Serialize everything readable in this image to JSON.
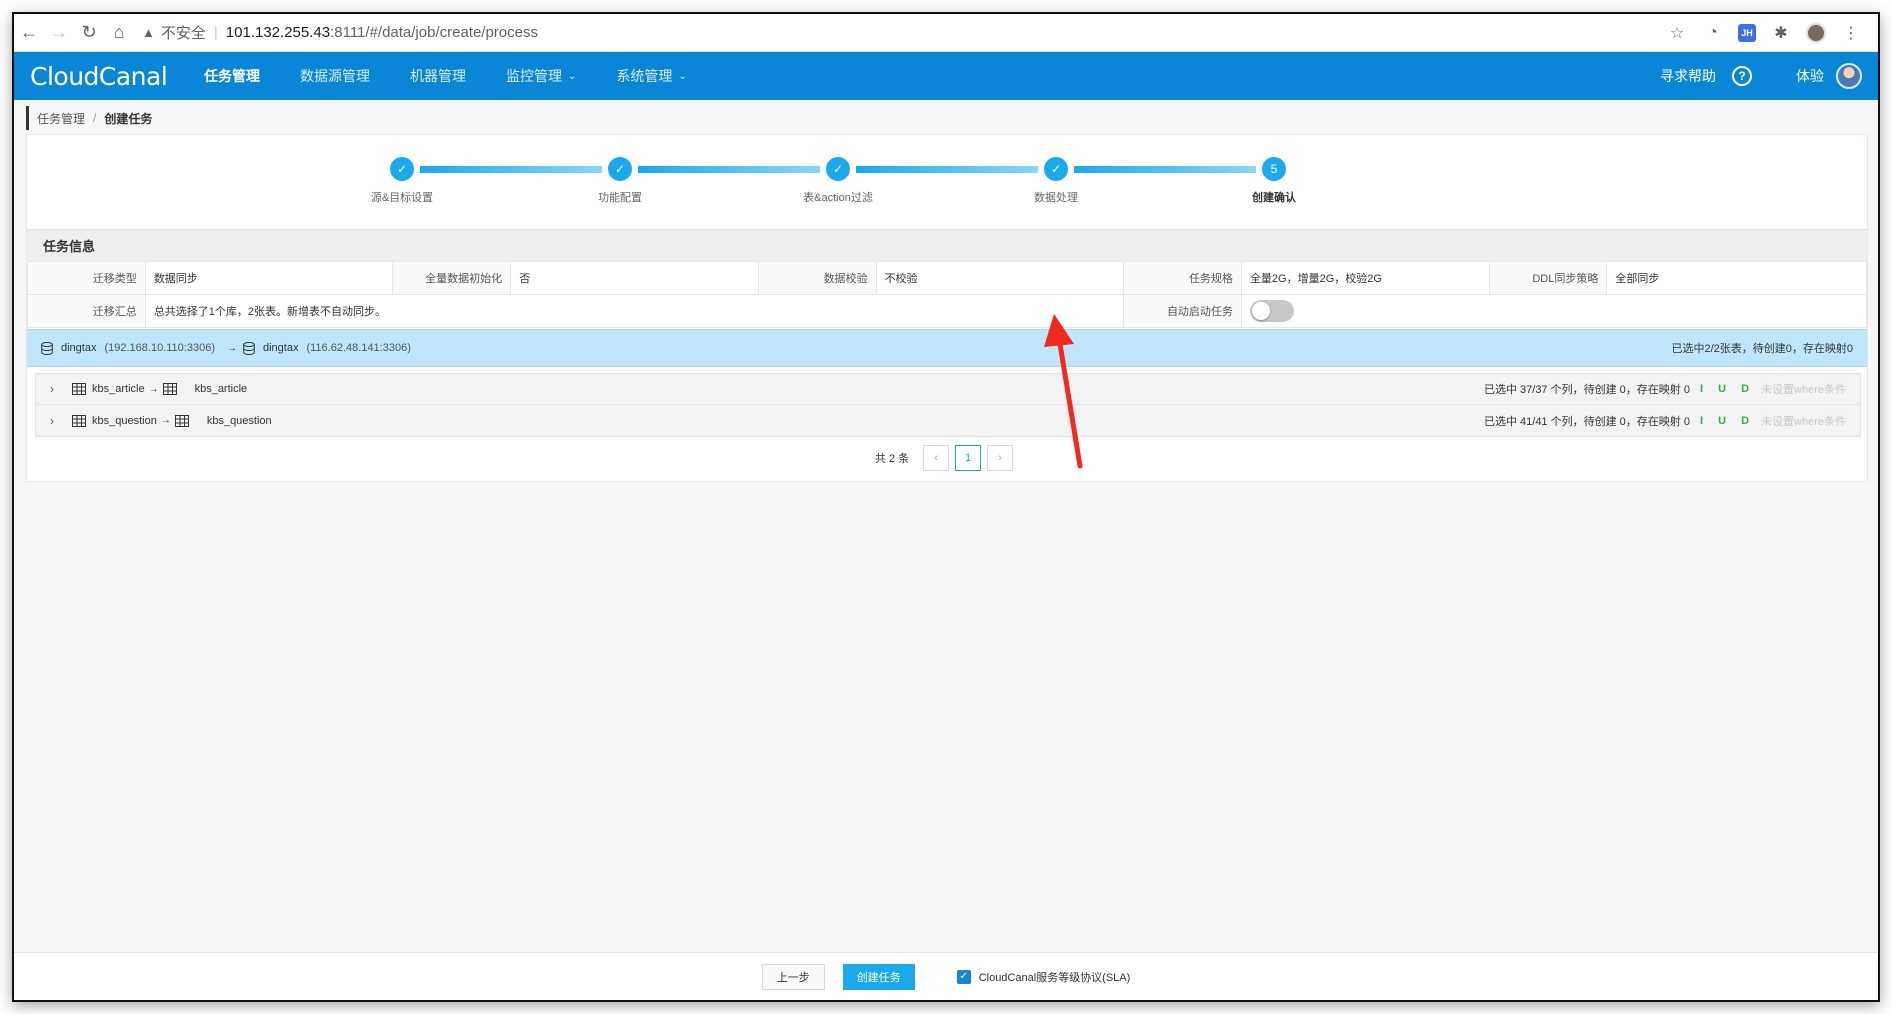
{
  "browser": {
    "insecure_label": "不安全",
    "url_host": "101.132.255.43",
    "url_path": ":8111/#/data/job/create/process"
  },
  "app": {
    "logo": "CloudCanal",
    "menu": [
      {
        "label": "任务管理",
        "active": true
      },
      {
        "label": "数据源管理"
      },
      {
        "label": "机器管理"
      },
      {
        "label": "监控管理"
      },
      {
        "label": "系统管理"
      }
    ],
    "help_link": "寻求帮助",
    "help_icon": "?",
    "user_name": "体验"
  },
  "breadcrumb": {
    "parent": "任务管理",
    "separator": "/",
    "current": "创建任务"
  },
  "steps": [
    {
      "label": "源&目标设置",
      "mark": "✓"
    },
    {
      "label": "功能配置",
      "mark": "✓"
    },
    {
      "label": "表&action过滤",
      "mark": "✓"
    },
    {
      "label": "数据处理",
      "mark": "✓"
    },
    {
      "label": "创建确认",
      "mark": "5"
    }
  ],
  "task_info": {
    "title": "任务信息",
    "row1": [
      {
        "label": "迁移类型",
        "value": "数据同步"
      },
      {
        "label": "全量数据初始化",
        "value": "否"
      },
      {
        "label": "数据校验",
        "value": "不校验"
      },
      {
        "label": "任务规格",
        "value": "全量2G，增量2G，校验2G"
      },
      {
        "label": "DDL同步策略",
        "value": "全部同步"
      }
    ],
    "row2": {
      "summary_label": "迁移汇总",
      "summary_value": "总共选择了1个库，2张表。新增表不自动同步。",
      "auto_start_label": "自动启动任务",
      "auto_start_on": false
    }
  },
  "db_mapping": {
    "source_db": "dingtax",
    "source_addr": "(192.168.10.110:3306)",
    "arrow": "→",
    "target_db": "dingtax",
    "target_addr": "(116.62.48.141:3306)",
    "summary": "已选中2/2张表，待创建0，存在映射0"
  },
  "tables": [
    {
      "source": "kbs_article",
      "target": "kbs_article",
      "stats": "已选中 37/37 个列，待创建 0，存在映射 0",
      "iud": "I U D",
      "where": "未设置where条件"
    },
    {
      "source": "kbs_question",
      "target": "kbs_question",
      "stats": "已选中 41/41 个列，待创建 0，存在映射 0",
      "iud": "I U D",
      "where": "未设置where条件"
    }
  ],
  "pagination": {
    "total": "共 2 条",
    "prev": "‹",
    "page": "1",
    "next": "›"
  },
  "footer": {
    "prev_label": "上一步",
    "create_label": "创建任务",
    "sla_label": "CloudCanal服务等级协议(SLA)",
    "sla_checked": true
  },
  "colors": {
    "header_bg": "#0a86d6",
    "accent": "#1ba9ec",
    "db_row_bg": "#bfe6fa",
    "iud_green": "#2eae4a",
    "annotation_red": "#f02a1e"
  }
}
